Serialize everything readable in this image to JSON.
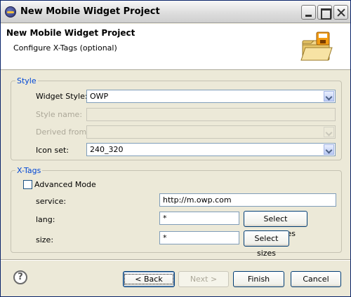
{
  "window": {
    "title": "New Mobile Widget Project"
  },
  "header": {
    "title": "New Mobile Widget Project",
    "subtitle": "Configure X-Tags (optional)"
  },
  "style_group": {
    "legend": "Style",
    "widget_style_label": "Widget Style:",
    "widget_style_value": "OWP",
    "style_name_label": "Style name:",
    "style_name_value": "",
    "derived_from_label": "Derived from:",
    "derived_from_value": "",
    "icon_set_label": "Icon set:",
    "icon_set_value": "240_320"
  },
  "xtags_group": {
    "legend": "X-Tags",
    "advanced_mode_label": "Advanced Mode",
    "service_label": "service:",
    "service_value": "http://m.owp.com",
    "lang_label": "lang:",
    "lang_value": "*",
    "select_languages_label": "Select languages",
    "size_label": "size:",
    "size_value": "*",
    "select_sizes_label": "Select sizes"
  },
  "footer": {
    "help_glyph": "?",
    "back_label": "< Back",
    "next_label": "Next >",
    "finish_label": "Finish",
    "cancel_label": "Cancel"
  },
  "colors": {
    "accent_legend": "#0046d5",
    "button_border": "#003c74",
    "disabled_text": "#aca899"
  }
}
